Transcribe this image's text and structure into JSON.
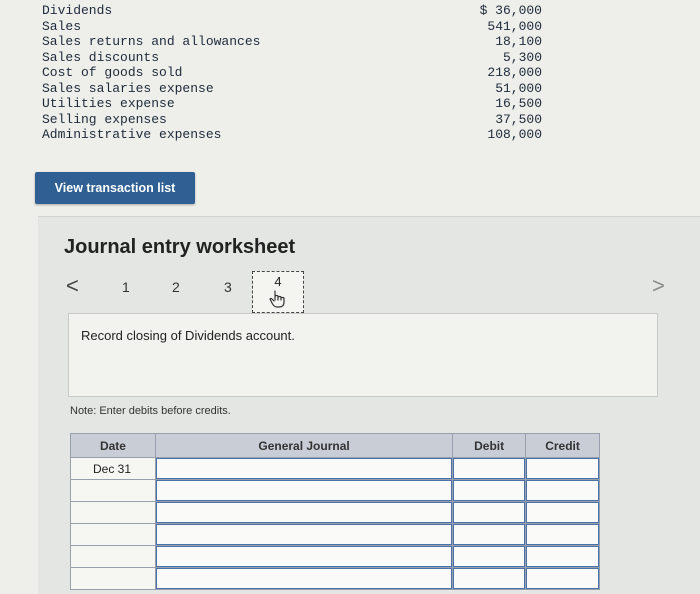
{
  "accounts": [
    {
      "name": "Dividends",
      "amount": "$ 36,000"
    },
    {
      "name": "Sales",
      "amount": "541,000"
    },
    {
      "name": "Sales returns and allowances",
      "amount": "18,100"
    },
    {
      "name": "Sales discounts",
      "amount": "5,300"
    },
    {
      "name": "Cost of goods sold",
      "amount": "218,000"
    },
    {
      "name": "Sales salaries expense",
      "amount": "51,000"
    },
    {
      "name": "Utilities expense",
      "amount": "16,500"
    },
    {
      "name": "Selling expenses",
      "amount": "37,500"
    },
    {
      "name": "Administrative expenses",
      "amount": "108,000"
    }
  ],
  "view_button": "View transaction list",
  "worksheet": {
    "title": "Journal entry worksheet",
    "nav_prev": "<",
    "nav_next": ">",
    "steps": [
      "1",
      "2",
      "3",
      "4"
    ],
    "current_step": "4",
    "instruction": "Record closing of Dividends account.",
    "note": "Note: Enter debits before credits."
  },
  "journal": {
    "headers": {
      "date": "Date",
      "general_journal": "General Journal",
      "debit": "Debit",
      "credit": "Credit"
    },
    "first_date": "Dec 31"
  }
}
